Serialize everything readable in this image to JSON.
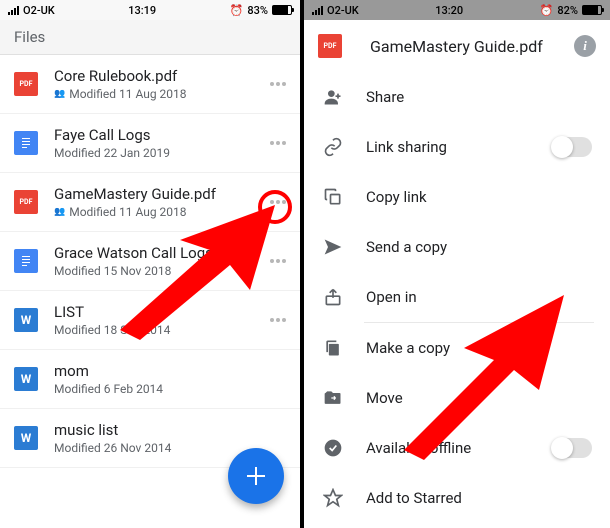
{
  "left": {
    "status": {
      "carrier": "O2-UK",
      "time": "13:19",
      "battery": "83%",
      "alarm": "⏰"
    },
    "header": "Files",
    "files": [
      {
        "name": "Core Rulebook.pdf",
        "meta": "Modified 11 Aug 2018",
        "type": "pdf",
        "shared": true
      },
      {
        "name": "Faye Call Logs",
        "meta": "Modified 22 Jan 2019",
        "type": "gdoc",
        "shared": false
      },
      {
        "name": "GameMastery Guide.pdf",
        "meta": "Modified 11 Aug 2018",
        "type": "pdf",
        "shared": true
      },
      {
        "name": "Grace Watson Call Logs",
        "meta": "Modified 15 Nov 2018",
        "type": "gdoc",
        "shared": false
      },
      {
        "name": "LIST",
        "meta": "Modified 18 Sep 2014",
        "type": "word",
        "shared": false
      },
      {
        "name": "mom",
        "meta": "Modified 6 Feb 2014",
        "type": "word",
        "shared": false
      },
      {
        "name": "music list",
        "meta": "Modified 26 Nov 2014",
        "type": "word",
        "shared": false
      }
    ]
  },
  "right": {
    "status": {
      "carrier": "O2-UK",
      "time": "13:20",
      "battery": "82%",
      "alarm": "⏰"
    },
    "title": "GameMastery Guide.pdf",
    "menu": [
      {
        "label": "Share",
        "icon": "share-person"
      },
      {
        "label": "Link sharing",
        "icon": "link",
        "toggle": true
      },
      {
        "label": "Copy link",
        "icon": "copy"
      },
      {
        "label": "Send a copy",
        "icon": "send"
      },
      {
        "label": "Open in",
        "icon": "open-in",
        "dividerAfter": true
      },
      {
        "label": "Make a copy",
        "icon": "make-copy"
      },
      {
        "label": "Move",
        "icon": "move"
      },
      {
        "label": "Available offline",
        "icon": "offline",
        "toggle": true
      },
      {
        "label": "Add to Starred",
        "icon": "star"
      }
    ]
  }
}
